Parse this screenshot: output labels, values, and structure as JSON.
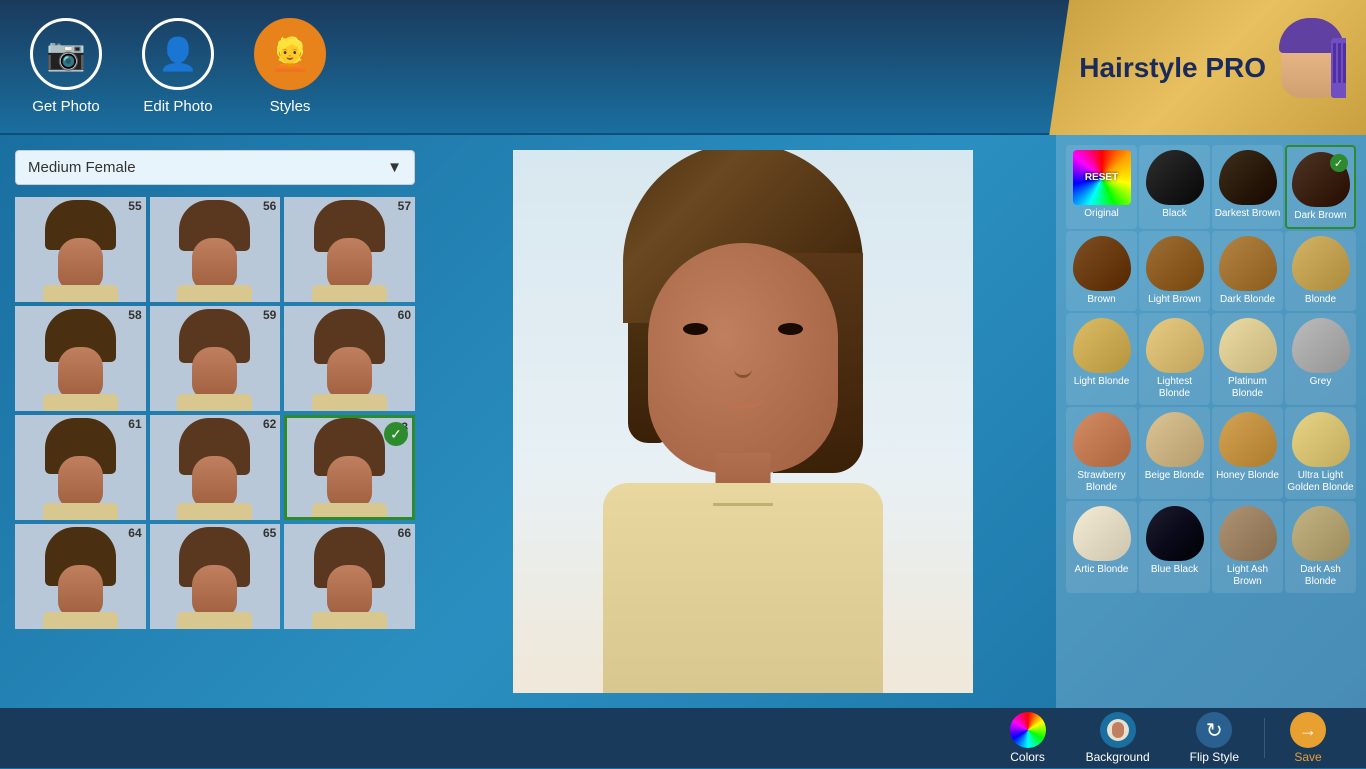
{
  "app": {
    "title": "Hairstyle PRO"
  },
  "header": {
    "nav": [
      {
        "id": "get-photo",
        "label": "Get Photo",
        "icon": "📷",
        "active": false
      },
      {
        "id": "edit-photo",
        "label": "Edit Photo",
        "icon": "👤",
        "active": false
      },
      {
        "id": "styles",
        "label": "Styles",
        "icon": "👱",
        "active": true
      }
    ]
  },
  "left_panel": {
    "dropdown_label": "Medium Female",
    "styles": [
      {
        "num": 55,
        "selected": false
      },
      {
        "num": 56,
        "selected": false
      },
      {
        "num": 57,
        "selected": false
      },
      {
        "num": 58,
        "selected": false
      },
      {
        "num": 59,
        "selected": false
      },
      {
        "num": 60,
        "selected": false
      },
      {
        "num": 61,
        "selected": false
      },
      {
        "num": 62,
        "selected": false
      },
      {
        "num": 63,
        "selected": true
      },
      {
        "num": 64,
        "selected": false
      },
      {
        "num": 65,
        "selected": false
      },
      {
        "num": 66,
        "selected": false
      }
    ]
  },
  "color_panel": {
    "colors": [
      {
        "id": "reset",
        "label": "Original",
        "type": "reset",
        "color": null
      },
      {
        "id": "black",
        "label": "Black",
        "color": "#1a1a1a"
      },
      {
        "id": "darkest-brown",
        "label": "Darkest Brown",
        "color": "#2a1a0a"
      },
      {
        "id": "dark-brown",
        "label": "Dark Brown",
        "color": "#3a2010",
        "selected": true
      },
      {
        "id": "brown",
        "label": "Brown",
        "color": "#6a3a10"
      },
      {
        "id": "light-brown",
        "label": "Light Brown",
        "color": "#8a5a20"
      },
      {
        "id": "dark-blonde",
        "label": "Dark Blonde",
        "color": "#a07030"
      },
      {
        "id": "blonde",
        "label": "Blonde",
        "color": "#c0a050"
      },
      {
        "id": "light-blonde",
        "label": "Light Blonde",
        "color": "#c8a850"
      },
      {
        "id": "lightest-blonde",
        "label": "Lightest Blonde",
        "color": "#d4b870"
      },
      {
        "id": "platinum-blonde",
        "label": "Platinum Blonde",
        "color": "#d8c890"
      },
      {
        "id": "grey",
        "label": "Grey",
        "color": "#a8a8a8"
      },
      {
        "id": "strawberry-blonde",
        "label": "Strawberry Blonde",
        "color": "#c07850"
      },
      {
        "id": "beige-blonde",
        "label": "Beige Blonde",
        "color": "#c8b080"
      },
      {
        "id": "honey-blonde",
        "label": "Honey Blonde",
        "color": "#c09040"
      },
      {
        "id": "ultra-light-golden-blonde",
        "label": "Ultra Light Golden Blonde",
        "color": "#d4c070"
      },
      {
        "id": "artic-blonde",
        "label": "Artic Blonde",
        "color": "#e0d8c0"
      },
      {
        "id": "blue-black",
        "label": "Blue Black",
        "color": "#0a0a1a"
      },
      {
        "id": "light-ash-brown",
        "label": "Light Ash Brown",
        "color": "#9a8060"
      },
      {
        "id": "dark-ash-blonde",
        "label": "Dark Ash Blonde",
        "color": "#b0a070"
      }
    ]
  },
  "toolbar": {
    "colors_label": "Colors",
    "background_label": "Background",
    "flip_style_label": "Flip Style",
    "save_label": "Save"
  }
}
